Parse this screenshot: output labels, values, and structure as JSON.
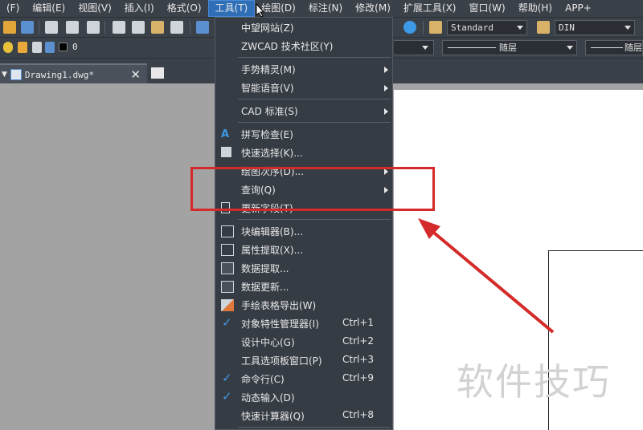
{
  "menubar": {
    "items": [
      {
        "label": "(F)"
      },
      {
        "label": "编辑(E)"
      },
      {
        "label": "视图(V)"
      },
      {
        "label": "插入(I)"
      },
      {
        "label": "格式(O)"
      },
      {
        "label": "工具(T)",
        "active": true
      },
      {
        "label": "绘图(D)"
      },
      {
        "label": "标注(N)"
      },
      {
        "label": "修改(M)"
      },
      {
        "label": "扩展工具(X)"
      },
      {
        "label": "窗口(W)"
      },
      {
        "label": "帮助(H)"
      },
      {
        "label": "APP+"
      }
    ]
  },
  "toolbar": {
    "text_style": "Standard",
    "dim_style": "DIN",
    "layer_value": "0",
    "linetype_1": "随层",
    "linetype_2": "随层"
  },
  "document_tab": {
    "label": "Drawing1.dwg*",
    "close": "✕"
  },
  "tools_menu": {
    "items": [
      {
        "label": "中望网站(Z)"
      },
      {
        "label": "ZWCAD 技术社区(Y)"
      },
      {
        "label": "手势精灵(M)",
        "submenu": true
      },
      {
        "label": "智能语音(V)",
        "submenu": true
      },
      {
        "label": "CAD 标准(S)",
        "submenu": true
      },
      {
        "label": "拼写检查(E)"
      },
      {
        "label": "快速选择(K)..."
      },
      {
        "label": "绘图次序(D)...",
        "submenu": true
      },
      {
        "label": "查询(Q)",
        "submenu": true
      },
      {
        "label": "更新字段(T)"
      },
      {
        "label": "块编辑器(B)..."
      },
      {
        "label": "属性提取(X)..."
      },
      {
        "label": "数据提取..."
      },
      {
        "label": "数据更新..."
      },
      {
        "label": "手绘表格导出(W)"
      },
      {
        "label": "对象特性管理器(I)",
        "shortcut": "Ctrl+1",
        "checked": true
      },
      {
        "label": "设计中心(G)",
        "shortcut": "Ctrl+2"
      },
      {
        "label": "工具选项板窗口(P)",
        "shortcut": "Ctrl+3"
      },
      {
        "label": "命令行(C)",
        "shortcut": "Ctrl+9",
        "checked": true
      },
      {
        "label": "动态输入(D)",
        "checked": true
      },
      {
        "label": "快速计算器(Q)",
        "shortcut": "Ctrl+8"
      }
    ]
  },
  "watermark": "软件技巧",
  "colors": {
    "highlight_box": "#d52a2a",
    "menu_bg": "#363c44",
    "active_menu": "#2f6fb8",
    "check": "#3d9ae8"
  }
}
